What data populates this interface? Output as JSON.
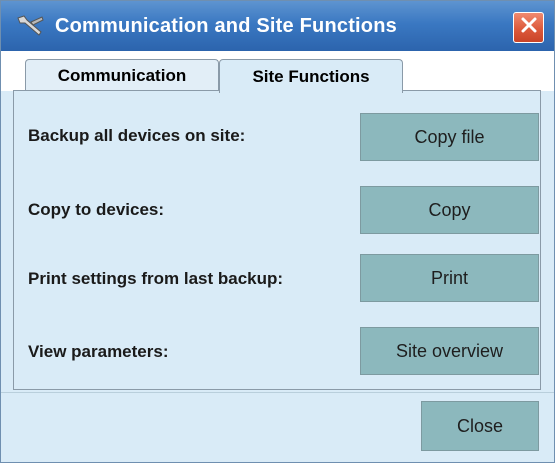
{
  "window": {
    "title": "Communication and Site Functions",
    "title_icon": "wrench-icon",
    "close_icon": "close-icon",
    "accent_color": "#3a78c2",
    "close_color": "#dd5a3c"
  },
  "tabs": [
    {
      "label": "Communication",
      "selected": false
    },
    {
      "label": "Site Functions",
      "selected": true
    }
  ],
  "site_functions": {
    "rows": [
      {
        "label": "Backup all devices on site:",
        "button": "Copy file"
      },
      {
        "label": "Copy to devices:",
        "button": "Copy"
      },
      {
        "label": "Print settings from last backup:",
        "button": "Print"
      },
      {
        "label": "View parameters:",
        "button": "Site overview"
      }
    ]
  },
  "footer": {
    "close_label": "Close"
  },
  "colors": {
    "panel_bg": "#d9ebf7",
    "button_bg": "#8cb8bd"
  }
}
